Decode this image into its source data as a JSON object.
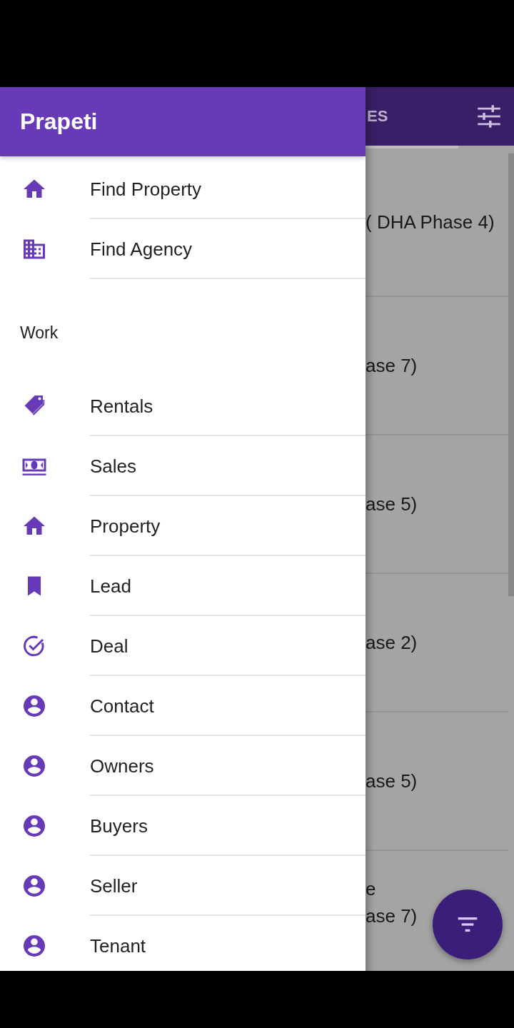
{
  "drawer": {
    "title": "Prapeti",
    "items": [
      {
        "label": "Find Property",
        "kind": "home"
      },
      {
        "label": "Find Agency",
        "kind": "building"
      }
    ],
    "section": "Work",
    "work_items": [
      {
        "label": "Rentals",
        "kind": "tag"
      },
      {
        "label": "Sales",
        "kind": "money"
      },
      {
        "label": "Property",
        "kind": "home"
      },
      {
        "label": "Lead",
        "kind": "bookmark"
      },
      {
        "label": "Deal",
        "kind": "check"
      },
      {
        "label": "Contact",
        "kind": "person"
      },
      {
        "label": "Owners",
        "kind": "person"
      },
      {
        "label": "Buyers",
        "kind": "person"
      },
      {
        "label": "Seller",
        "kind": "person"
      },
      {
        "label": "Tenant",
        "kind": "person"
      }
    ]
  },
  "background": {
    "tab": "ES",
    "cards": [
      {
        "lines": [
          "( DHA Phase 4)"
        ]
      },
      {
        "lines": [
          "ase 7)"
        ]
      },
      {
        "lines": [
          "ase 5)"
        ]
      },
      {
        "lines": [
          "ase 2)"
        ]
      },
      {
        "lines": [
          "ase 5)"
        ]
      },
      {
        "lines": [
          "e",
          "ase 7)"
        ]
      }
    ]
  }
}
